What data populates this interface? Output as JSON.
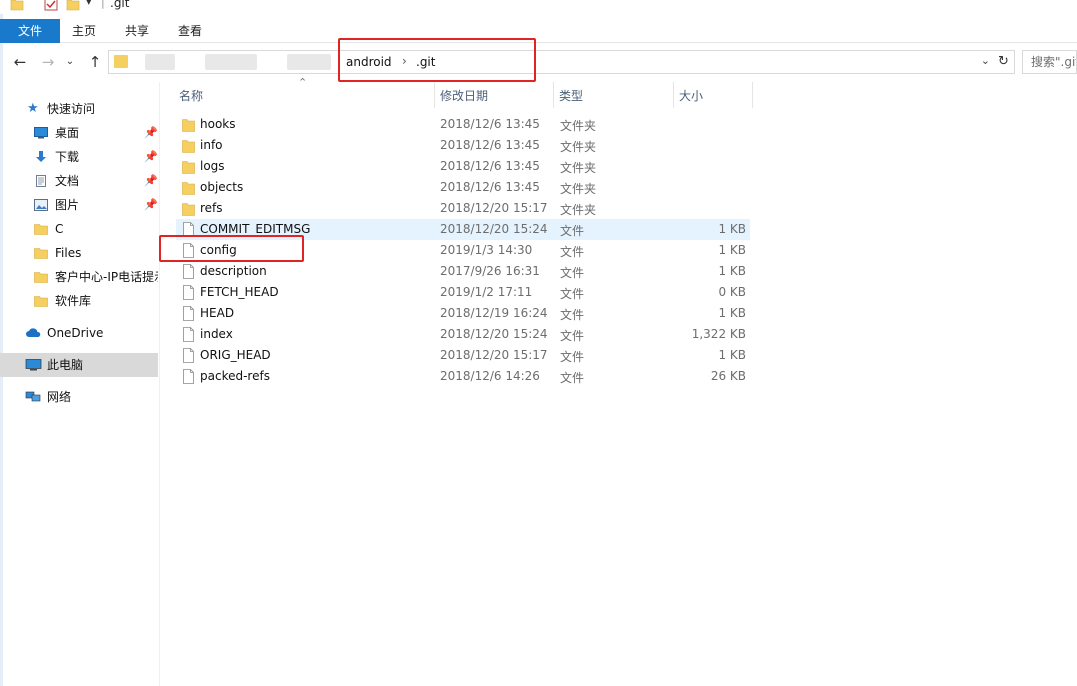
{
  "window": {
    "title": ".git"
  },
  "ribbon": {
    "tabs": [
      "文件",
      "主页",
      "共享",
      "查看"
    ]
  },
  "address": {
    "crumbs": [
      "android",
      ".git"
    ],
    "search_placeholder": "搜索\".git\""
  },
  "nav_pane": {
    "quick_access": "快速访问",
    "items": [
      {
        "label": "桌面",
        "icon": "desktop-icon",
        "pinned": true
      },
      {
        "label": "下载",
        "icon": "download-icon",
        "pinned": true
      },
      {
        "label": "文档",
        "icon": "document-icon",
        "pinned": true
      },
      {
        "label": "图片",
        "icon": "picture-icon",
        "pinned": true
      },
      {
        "label": "C",
        "icon": "folder-icon",
        "pinned": false
      },
      {
        "label": "Files",
        "icon": "folder-icon",
        "pinned": false
      },
      {
        "label": "客户中心-IP电话提示",
        "icon": "folder-icon",
        "pinned": false
      },
      {
        "label": "软件库",
        "icon": "folder-icon",
        "pinned": false
      }
    ],
    "onedrive": "OneDrive",
    "this_pc": "此电脑",
    "network": "网络"
  },
  "columns": {
    "name": "名称",
    "date": "修改日期",
    "type": "类型",
    "size": "大小"
  },
  "files": [
    {
      "name": "hooks",
      "date": "2018/12/6 13:45",
      "type": "文件夹",
      "size": "",
      "kind": "folder"
    },
    {
      "name": "info",
      "date": "2018/12/6 13:45",
      "type": "文件夹",
      "size": "",
      "kind": "folder"
    },
    {
      "name": "logs",
      "date": "2018/12/6 13:45",
      "type": "文件夹",
      "size": "",
      "kind": "folder"
    },
    {
      "name": "objects",
      "date": "2018/12/6 13:45",
      "type": "文件夹",
      "size": "",
      "kind": "folder"
    },
    {
      "name": "refs",
      "date": "2018/12/20 15:17",
      "type": "文件夹",
      "size": "",
      "kind": "folder"
    },
    {
      "name": "COMMIT_EDITMSG",
      "date": "2018/12/20 15:24",
      "type": "文件",
      "size": "1 KB",
      "kind": "file"
    },
    {
      "name": "config",
      "date": "2019/1/3 14:30",
      "type": "文件",
      "size": "1 KB",
      "kind": "file"
    },
    {
      "name": "description",
      "date": "2017/9/26 16:31",
      "type": "文件",
      "size": "1 KB",
      "kind": "file"
    },
    {
      "name": "FETCH_HEAD",
      "date": "2019/1/2 17:11",
      "type": "文件",
      "size": "0 KB",
      "kind": "file"
    },
    {
      "name": "HEAD",
      "date": "2018/12/19 16:24",
      "type": "文件",
      "size": "1 KB",
      "kind": "file"
    },
    {
      "name": "index",
      "date": "2018/12/20 15:24",
      "type": "文件",
      "size": "1,322 KB",
      "kind": "file"
    },
    {
      "name": "ORIG_HEAD",
      "date": "2018/12/20 15:17",
      "type": "文件",
      "size": "1 KB",
      "kind": "file"
    },
    {
      "name": "packed-refs",
      "date": "2018/12/6 14:26",
      "type": "文件",
      "size": "26 KB",
      "kind": "file"
    }
  ],
  "colors": {
    "accent": "#1979ca",
    "folder": "#f6cf61",
    "highlight_box": "#e02323",
    "hover_row": "#e5f3ff"
  }
}
